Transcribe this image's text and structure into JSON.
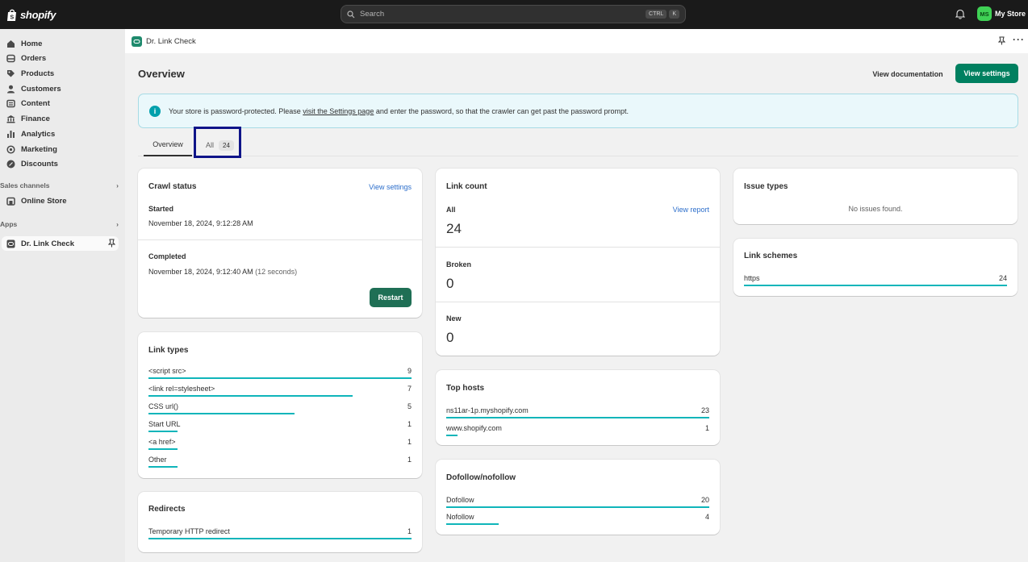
{
  "topbar": {
    "logo": "shopify",
    "search_placeholder": "Search",
    "shortcut": [
      "CTRL",
      "K"
    ],
    "avatar_initials": "MS",
    "store_name": "My Store"
  },
  "sidebar": {
    "items": [
      {
        "label": "Home",
        "icon": "home-icon"
      },
      {
        "label": "Orders",
        "icon": "inbox-icon"
      },
      {
        "label": "Products",
        "icon": "tag-icon"
      },
      {
        "label": "Customers",
        "icon": "person-icon"
      },
      {
        "label": "Content",
        "icon": "content-icon"
      },
      {
        "label": "Finance",
        "icon": "bank-icon"
      },
      {
        "label": "Analytics",
        "icon": "chart-bars-icon"
      },
      {
        "label": "Marketing",
        "icon": "target-icon"
      },
      {
        "label": "Discounts",
        "icon": "discount-icon"
      }
    ],
    "sales_channels_heading": "Sales channels",
    "online_store": "Online Store",
    "apps_heading": "Apps",
    "active_app": "Dr. Link Check"
  },
  "appbar": {
    "title": "Dr. Link Check"
  },
  "page": {
    "title": "Overview",
    "view_documentation": "View documentation",
    "view_settings": "View settings"
  },
  "banner": {
    "text_before": "Your store is password-protected. Please ",
    "link_text": "visit the Settings page",
    "text_after": " and enter the password, so that the crawler can get past the password prompt."
  },
  "tabs": {
    "overview": "Overview",
    "all": "All",
    "all_count": "24"
  },
  "crawl_status": {
    "title": "Crawl status",
    "view_settings": "View settings",
    "started_label": "Started",
    "started_value": "November 18, 2024, 9:12:28 AM",
    "completed_label": "Completed",
    "completed_value": "November 18, 2024, 9:12:40 AM",
    "duration": "(12 seconds)",
    "restart": "Restart"
  },
  "link_types": {
    "title": "Link types",
    "rows": [
      {
        "label": "<script src>",
        "value": 9
      },
      {
        "label": "<link rel=stylesheet>",
        "value": 7
      },
      {
        "label": "CSS url()",
        "value": 5
      },
      {
        "label": "Start URL",
        "value": 1
      },
      {
        "label": "<a href>",
        "value": 1
      },
      {
        "label": "Other",
        "value": 1
      }
    ]
  },
  "redirects": {
    "title": "Redirects",
    "rows": [
      {
        "label": "Temporary HTTP redirect",
        "value": 1
      }
    ]
  },
  "link_count": {
    "title": "Link count",
    "all_label": "All",
    "all_value": "24",
    "view_report": "View report",
    "broken_label": "Broken",
    "broken_value": "0",
    "new_label": "New",
    "new_value": "0"
  },
  "top_hosts": {
    "title": "Top hosts",
    "rows": [
      {
        "label": "ns11ar-1p.myshopify.com",
        "value": 23
      },
      {
        "label": "www.shopify.com",
        "value": 1
      }
    ]
  },
  "dofollow": {
    "title": "Dofollow/nofollow",
    "rows": [
      {
        "label": "Dofollow",
        "value": 20
      },
      {
        "label": "Nofollow",
        "value": 4
      }
    ]
  },
  "issue_types": {
    "title": "Issue types",
    "empty_text": "No issues found."
  },
  "link_schemes": {
    "title": "Link schemes",
    "rows": [
      {
        "label": "https",
        "value": 24
      }
    ]
  },
  "colors": {
    "accent": "#008060",
    "bar": "#0fb5ba",
    "link": "#2c6ecb"
  }
}
